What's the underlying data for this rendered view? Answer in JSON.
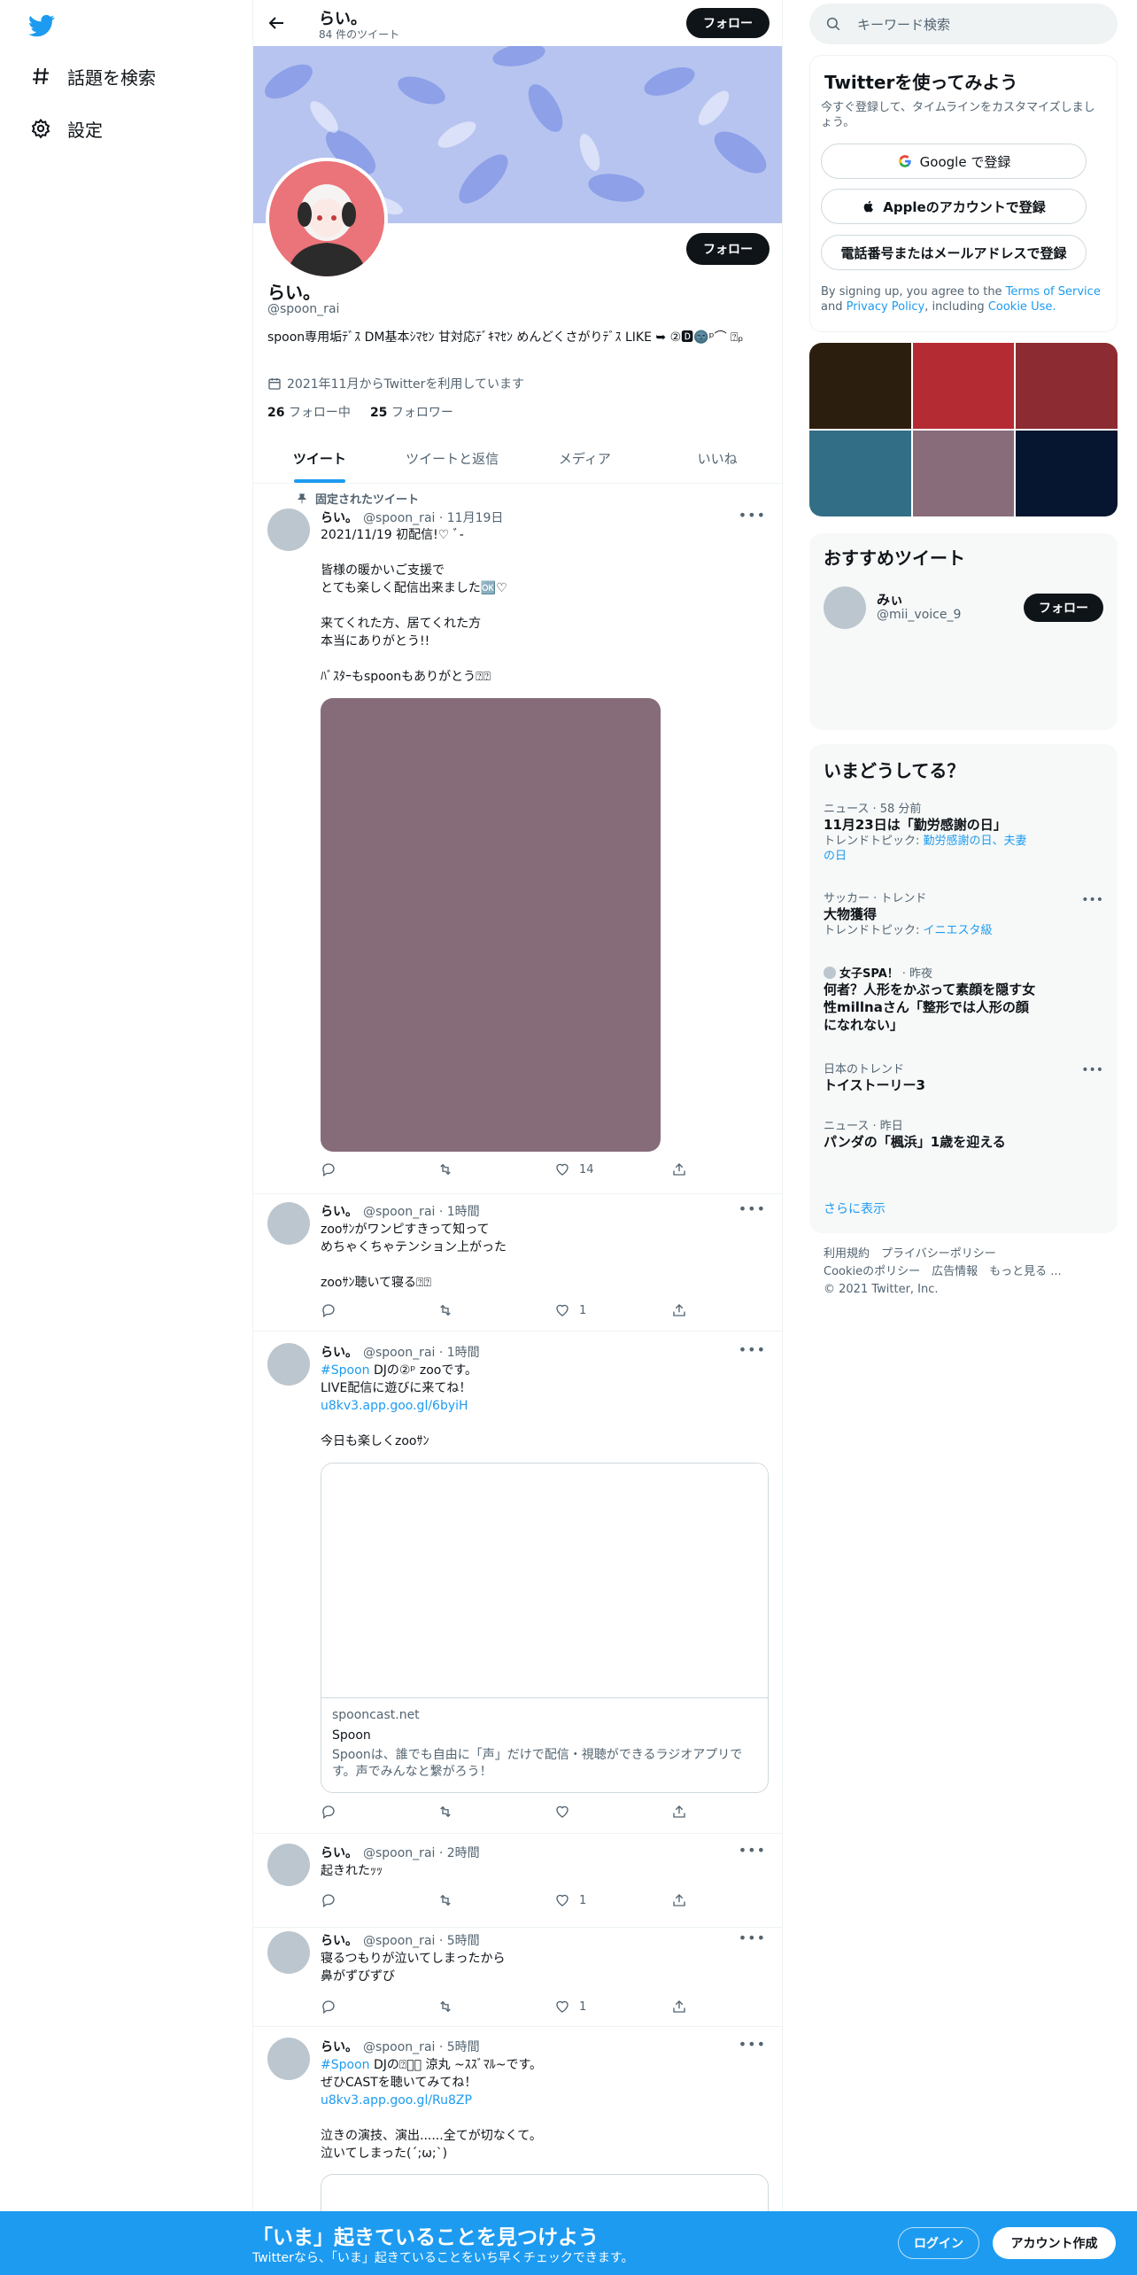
{
  "app": {
    "title": "らい。 (@spoon_rai) / Twitter"
  },
  "nav": {
    "explore_label": "話題を検索",
    "settings_label": "設定"
  },
  "header": {
    "name": "らい。",
    "tweet_count": "84 件のツイート",
    "follow_label": "フォロー"
  },
  "profile": {
    "name": "らい。",
    "handle": "@spoon_rai",
    "bio": "spoon専用垢ﾃﾞｽ DM基本ｼﾏｾﾝ 甘対応ﾃﾞｷﾏｾﾝ めんどくさがりﾃﾞｽ LIKE ➥ ②🅳🌚ᵖ⌒ ⍰ₚ",
    "joined": "2021年11月からTwitterを利用しています",
    "following_count": "26",
    "following_label": "フォロー中",
    "followers_count": "25",
    "followers_label": "フォロワー",
    "follow_label": "フォロー"
  },
  "tabs": [
    "ツイート",
    "ツイートと返信",
    "メディア",
    "いいね"
  ],
  "pinned_label": "固定されたツイート",
  "tweets": [
    {
      "name": "らい。",
      "meta": "@spoon_rai · 11月19日",
      "text": "2021/11/19 初配信!♡ ﾞ-\n\n皆様の暖かいご支援で\nとても楽しく配信出来ました🆗♡\n\n来てくれた方、居てくれた方\n本当にありがとう!!\n\nﾊﾞｽﾀｰもspoonもありがとう⍰⍰",
      "likes": "14"
    },
    {
      "name": "らい。",
      "meta": "@spoon_rai · 1時間",
      "text": "zooｻﾝがワンピすきって知って\nめちゃくちゃテンション上がった\n\nzooｻﾝ聴いて寝る⍰⍰",
      "likes": "1"
    },
    {
      "name": "らい。",
      "meta": "@spoon_rai · 1時間",
      "hashtag": "#Spoon",
      "text_after_tag": " DJの②ᵖ zooです。",
      "line2": "LIVE配信に遊びに来てね！",
      "link": "u8kv3.app.goo.gl/6byiH",
      "line4": "今日も楽しくzooｻﾝ",
      "likes": ""
    },
    {
      "name": "らい。",
      "meta": "@spoon_rai · 2時間",
      "text": "起きれたｯｯ",
      "likes": "1"
    },
    {
      "name": "らい。",
      "meta": "@spoon_rai · 5時間",
      "text": "寝るつもりが泣いてしまったから\n鼻がずびずび",
      "likes": "1"
    },
    {
      "name": "らい。",
      "meta": "@spoon_rai · 5時間",
      "hashtag": "#Spoon",
      "text_after_tag": " DJの⍰⍰ﾞ 涼丸 ~ｽｽﾞﾏﾙ~です。",
      "line2": "ぜひCASTを聴いてみてね！",
      "link": "u8kv3.app.goo.gl/Ru8ZP",
      "line4": "泣きの演技、演出......全てが切なくて。\n泣いてしまった(´;ω;`)"
    }
  ],
  "card": {
    "domain": "spooncast.net",
    "title": "Spoon",
    "desc": "Spoonは、誰でも自由に「声」だけで配信・視聴ができるラジオアプリです。声でみんなと繋がろう！"
  },
  "search": {
    "placeholder": "キーワード検索"
  },
  "signup_box": {
    "title": "Twitterを使ってみよう",
    "subtitle": "今すぐ登録して、タイムラインをカスタマイズしましょう。",
    "google": "Google で登録",
    "apple": "Appleのアカウントで登録",
    "phone": "電話番号またはメールアドレスで登録",
    "terms_prefix": "By signing up, you agree to the ",
    "terms": "Terms of Service",
    "and": " and ",
    "privacy": "Privacy Policy",
    "including": ", including ",
    "cookie": "Cookie Use."
  },
  "photo_colors": [
    "#2c1e0f",
    "#b52b33",
    "#8d2b32",
    "#326f86",
    "#886c79",
    "#061630"
  ],
  "recommended": {
    "title": "おすすめツイート",
    "user_name": "みぃ",
    "user_handle": "@mii_voice_9",
    "follow_label": "フォロー"
  },
  "trends": {
    "title": "いまどうしてる？",
    "items": [
      {
        "meta": "ニュース · 58 分前",
        "title": "11月23日は「勤労感謝の日」",
        "sub_prefix": "トレンドトピック: ",
        "sub_link": "勤労感謝の日、夫妻の日"
      },
      {
        "meta": "サッカー · トレンド",
        "title": "大物獲得",
        "sub_prefix": "トレンドトピック: ",
        "sub_link": "イニエスタ級"
      },
      {
        "meta_source": "女子SPA！",
        "meta": " · 昨夜",
        "title": "何者？人形をかぶって素顔を隠す女性millnaさん「整形では人形の顔になれない」"
      },
      {
        "meta": "日本のトレンド",
        "title": "トイストーリー3"
      },
      {
        "meta": "ニュース · 昨日",
        "title": "パンダの「楓浜」1歳を迎える"
      }
    ],
    "show_more": "さらに表示"
  },
  "footer": {
    "line1": "利用規約　プライバシーポリシー",
    "line2": "Cookieのポリシー　広告情報　もっと見る ...",
    "line3": "© 2021 Twitter, Inc."
  },
  "bottom_bar": {
    "title": "「いま」起きていることを見つけよう",
    "subtitle": "Twitterなら、「いま」起きていることをいち早くチェックできます。",
    "login": "ログイン",
    "signup": "アカウント作成"
  }
}
